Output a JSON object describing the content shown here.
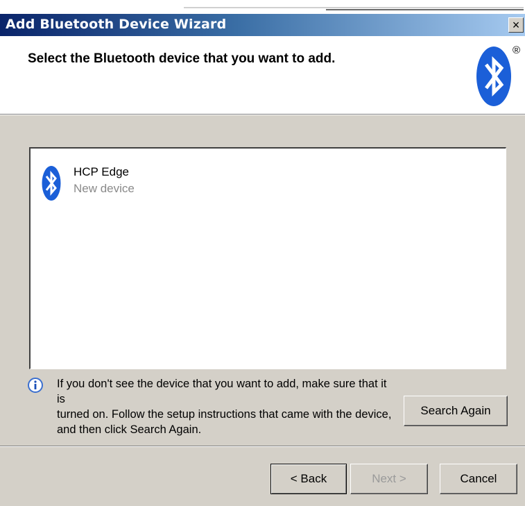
{
  "window": {
    "title": "Add Bluetooth Device Wizard",
    "close_label": "×"
  },
  "header": {
    "heading": "Select the Bluetooth device that you want to add.",
    "registered_mark": "®"
  },
  "devices": [
    {
      "name": "HCP Edge",
      "status": "New device",
      "icon": "bluetooth-icon"
    }
  ],
  "info": {
    "icon": "info-icon",
    "line1": "If you don't see the device that you want to add, make sure that it is",
    "line2": "turned on. Follow the setup instructions that came with the device,",
    "line3": "and then click Search Again."
  },
  "buttons": {
    "search_again": "Search Again",
    "back": "< Back",
    "next": "Next >",
    "cancel": "Cancel"
  },
  "colors": {
    "titlebar_start": "#0a246a",
    "titlebar_end": "#a6caf0",
    "dialog_face": "#d4d0c8",
    "bluetooth_blue": "#1b5fd8"
  }
}
